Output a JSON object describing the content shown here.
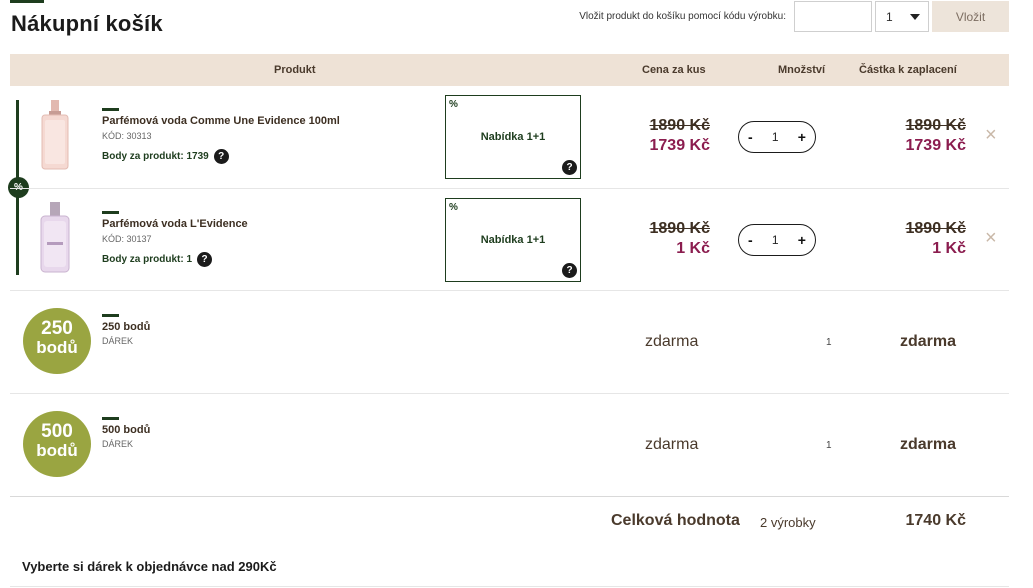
{
  "page": {
    "title": "Nákupní košík"
  },
  "add_by_code": {
    "label": "Vložit produkt do košíku pomocí kódu výrobku:",
    "code_value": "",
    "quantity_selected": "1",
    "button_label": "Vložit"
  },
  "table": {
    "headers": {
      "product": "Produkt",
      "unit_price": "Cena za kus",
      "quantity": "Množství",
      "amount": "Částka k zaplacení"
    }
  },
  "promo_badge": "%",
  "items": [
    {
      "name": "Parfémová voda Comme Une Evidence 100ml",
      "code": "KÓD: 30313",
      "points": "Body za produkt: 1739",
      "offer_percent": "%",
      "offer_label": "Nabídka 1+1",
      "offer_help": "?",
      "points_help": "?",
      "price_old": "1890 Kč",
      "price_new": "1739 Kč",
      "qty_minus": "-",
      "qty": "1",
      "qty_plus": "+",
      "amount_old": "1890 Kč",
      "amount_new": "1739 Kč",
      "remove": "×"
    },
    {
      "name": "Parfémová voda L'Evidence",
      "code": "KÓD: 30137",
      "points": "Body za produkt: 1",
      "offer_percent": "%",
      "offer_label": "Nabídka 1+1",
      "offer_help": "?",
      "points_help": "?",
      "price_old": "1890 Kč",
      "price_new": "1 Kč",
      "qty_minus": "-",
      "qty": "1",
      "qty_plus": "+",
      "amount_old": "1890 Kč",
      "amount_new": "1 Kč",
      "remove": "×"
    }
  ],
  "gifts": [
    {
      "circle_num": "250",
      "circle_label": "bodů",
      "name": "250 bodů",
      "type": "DÁREK",
      "price": "zdarma",
      "qty": "1",
      "amount": "zdarma"
    },
    {
      "circle_num": "500",
      "circle_label": "bodů",
      "name": "500 bodů",
      "type": "DÁREK",
      "price": "zdarma",
      "qty": "1",
      "amount": "zdarma"
    }
  ],
  "total": {
    "label": "Celková hodnota",
    "count": "2 výrobky",
    "value": "1740 Kč"
  },
  "gift_note": "Vyberte si dárek k objednávce nad 290Kč",
  "colors": {
    "accent_green": "#1e3d1e",
    "header_beige": "#eee2d6",
    "sale_price": "#8b1d4f",
    "gift_olive": "#9aa541"
  }
}
